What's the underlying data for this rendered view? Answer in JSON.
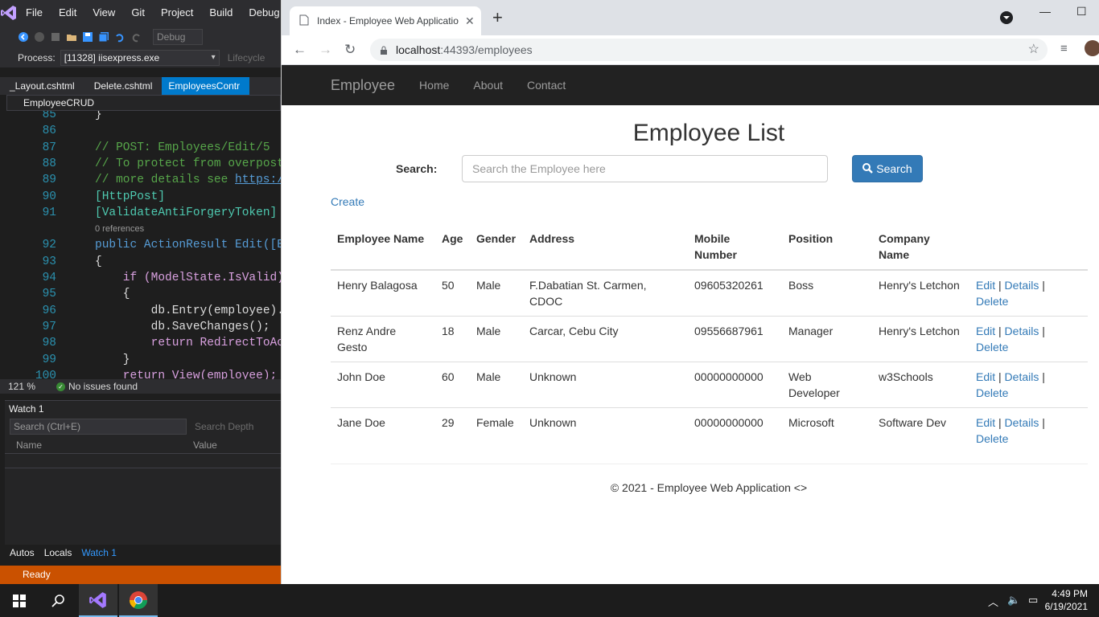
{
  "vs": {
    "menu": [
      "File",
      "Edit",
      "View",
      "Git",
      "Project",
      "Build",
      "Debug"
    ],
    "toolbar": {
      "config": "Debug"
    },
    "process": {
      "label": "Process:",
      "value": "[11328] iisexpress.exe",
      "lifecycle": "Lifecycle"
    },
    "tabs": [
      "_Layout.cshtml",
      "Delete.cshtml",
      "EmployeesContr"
    ],
    "nav_project": "EmployeeCRUD",
    "code_lines": [
      {
        "n": "85",
        "t": "}"
      },
      {
        "n": "86",
        "t": ""
      },
      {
        "n": "87",
        "t": "// POST: Employees/Edit/5"
      },
      {
        "n": "88",
        "t": "// To protect from overpost"
      },
      {
        "n": "89",
        "t": "// more details see ",
        "link": "https:/"
      },
      {
        "n": "90",
        "t": "[HttpPost]"
      },
      {
        "n": "91",
        "t": "[ValidateAntiForgeryToken]"
      },
      {
        "n": "",
        "t": "0 references"
      },
      {
        "n": "92",
        "t": "public ActionResult Edit([B"
      },
      {
        "n": "93",
        "t": "{"
      },
      {
        "n": "94",
        "t": "    if (ModelState.IsValid)"
      },
      {
        "n": "95",
        "t": "    {"
      },
      {
        "n": "96",
        "t": "        db.Entry(employee)."
      },
      {
        "n": "97",
        "t": "        db.SaveChanges();"
      },
      {
        "n": "98",
        "t": "        return RedirectToAc"
      },
      {
        "n": "99",
        "t": "    }"
      },
      {
        "n": "100",
        "t": "    return View(employee);"
      }
    ],
    "zoom": "121 %",
    "issues": "No issues found",
    "watch": {
      "title": "Watch 1",
      "search_placeholder": "Search (Ctrl+E)",
      "search_depth": "Search Depth",
      "col_name": "Name",
      "col_value": "Value"
    },
    "debug_tabs": [
      "Autos",
      "Locals",
      "Watch 1"
    ],
    "status": "Ready"
  },
  "browser": {
    "tab_title": "Index - Employee Web Applicatio",
    "url_host": "localhost",
    "url_path": ":44393/employees"
  },
  "page": {
    "brand": "Employee",
    "nav": [
      "Home",
      "About",
      "Contact"
    ],
    "heading": "Employee List",
    "search_label": "Search:",
    "search_placeholder": "Search the Employee here",
    "search_button": "Search",
    "create_link": "Create",
    "columns": [
      "Employee Name",
      "Age",
      "Gender",
      "Address",
      "Mobile Number",
      "Position",
      "Company Name",
      ""
    ],
    "rows": [
      [
        "Henry Balagosa",
        "50",
        "Male",
        "F.Dabatian St. Carmen, CDOC",
        "09605320261",
        "Boss",
        "Henry's Letchon"
      ],
      [
        "Renz Andre Gesto",
        "18",
        "Male",
        "Carcar, Cebu City",
        "09556687961",
        "Manager",
        "Henry's Letchon"
      ],
      [
        "John Doe",
        "60",
        "Male",
        "Unknown",
        "00000000000",
        "Web Developer",
        "w3Schools"
      ],
      [
        "Jane Doe",
        "29",
        "Female",
        "Unknown",
        "00000000000",
        "Microsoft",
        "Software Dev"
      ]
    ],
    "actions": {
      "edit": "Edit",
      "details": "Details",
      "delete": "Delete",
      "sep": "|"
    },
    "footer": "© 2021 - Employee Web Application <>"
  },
  "taskbar": {
    "time": "4:49 PM",
    "date": "6/19/2021"
  }
}
